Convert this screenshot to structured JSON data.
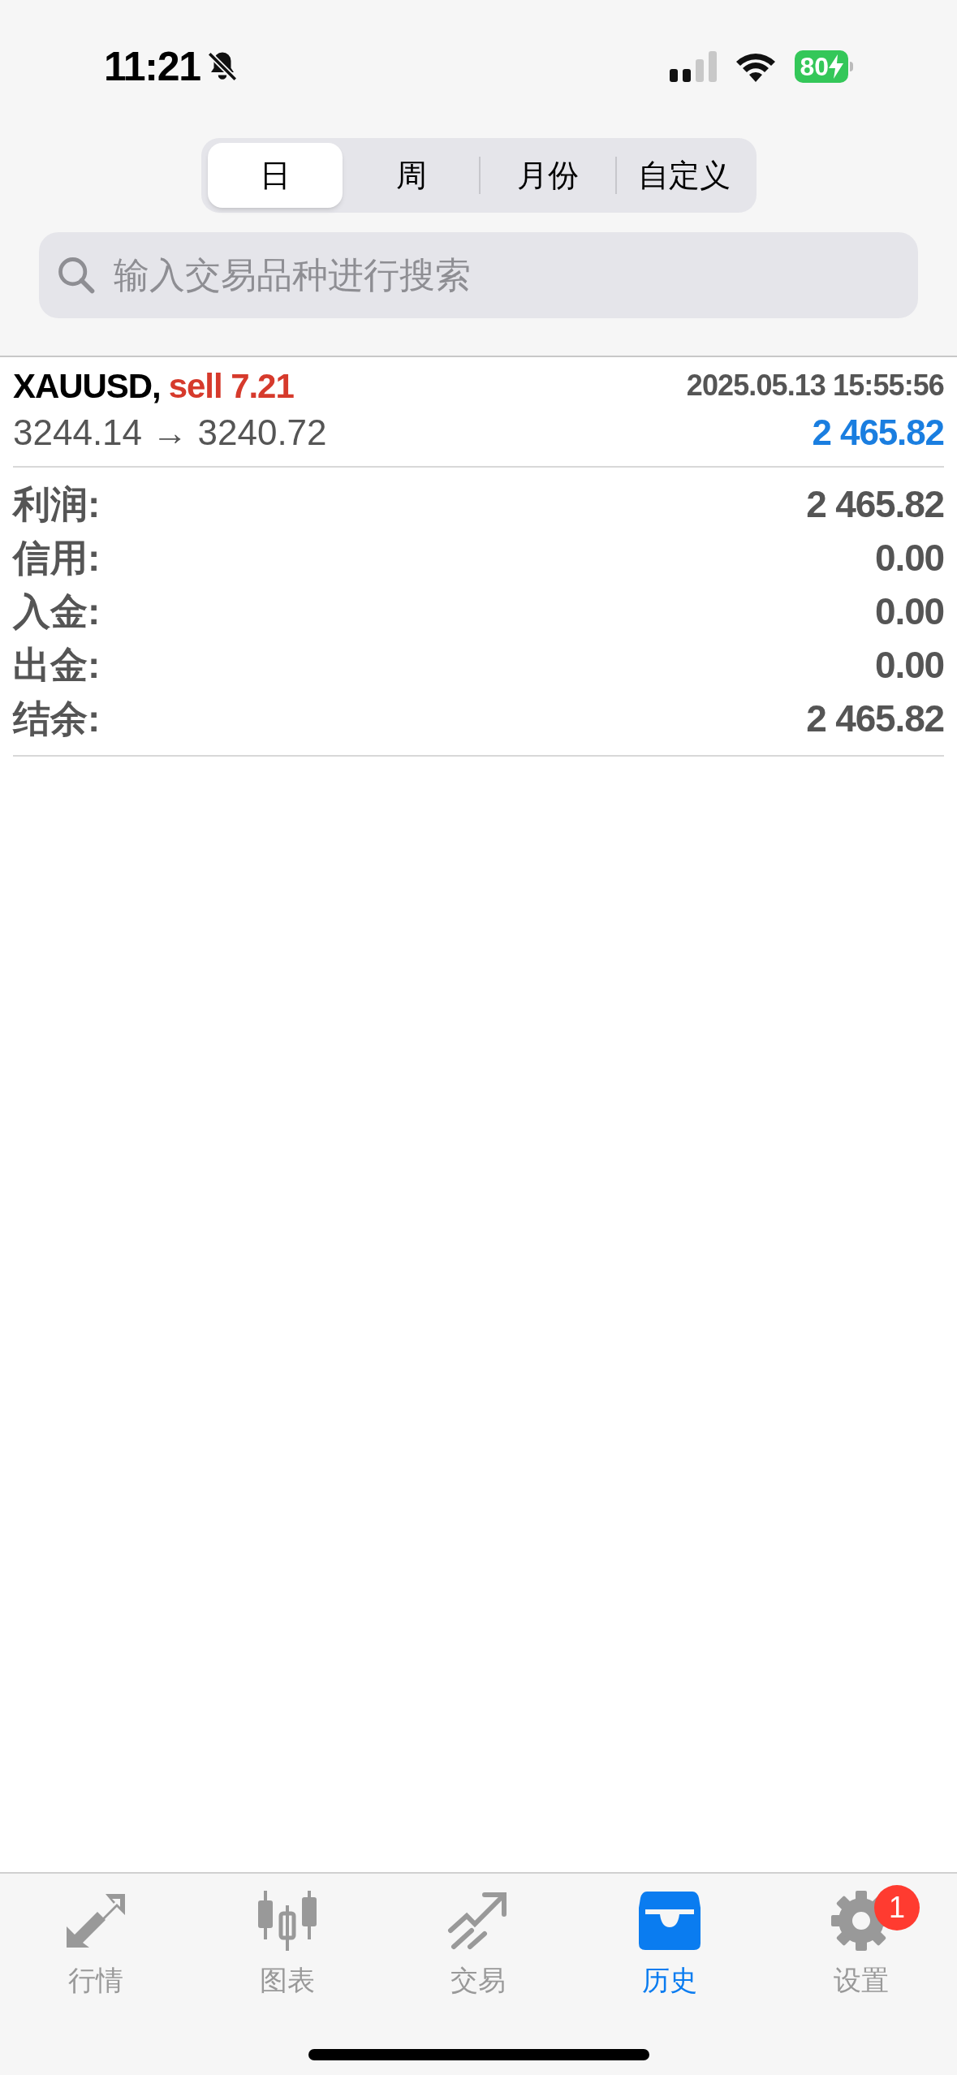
{
  "status_bar": {
    "time": "11:21",
    "silent": true,
    "battery": "80",
    "charging": true
  },
  "period_tabs": [
    {
      "label": "日",
      "selected": true
    },
    {
      "label": "周",
      "selected": false
    },
    {
      "label": "月份",
      "selected": false
    },
    {
      "label": "自定义",
      "selected": false
    }
  ],
  "search": {
    "placeholder": "输入交易品种进行搜索"
  },
  "trades": [
    {
      "symbol": "XAUUSD,",
      "side": "sell 7.21",
      "time": "2025.05.13 15:55:56",
      "prices": "3244.14 → 3240.72",
      "profit": "2 465.82"
    }
  ],
  "summary": [
    {
      "label": "利润:",
      "value": "2 465.82"
    },
    {
      "label": "信用:",
      "value": "0.00"
    },
    {
      "label": "入金:",
      "value": "0.00"
    },
    {
      "label": "出金:",
      "value": "0.00"
    },
    {
      "label": "结余:",
      "value": "2 465.82"
    }
  ],
  "tab_bar": [
    {
      "kind": "quotes",
      "label": "行情",
      "selected": false
    },
    {
      "kind": "chart",
      "label": "图表",
      "selected": false
    },
    {
      "kind": "trade",
      "label": "交易",
      "selected": false
    },
    {
      "kind": "history",
      "label": "历史",
      "selected": true
    },
    {
      "kind": "settings",
      "label": "设置",
      "selected": false,
      "badge": "1"
    }
  ]
}
